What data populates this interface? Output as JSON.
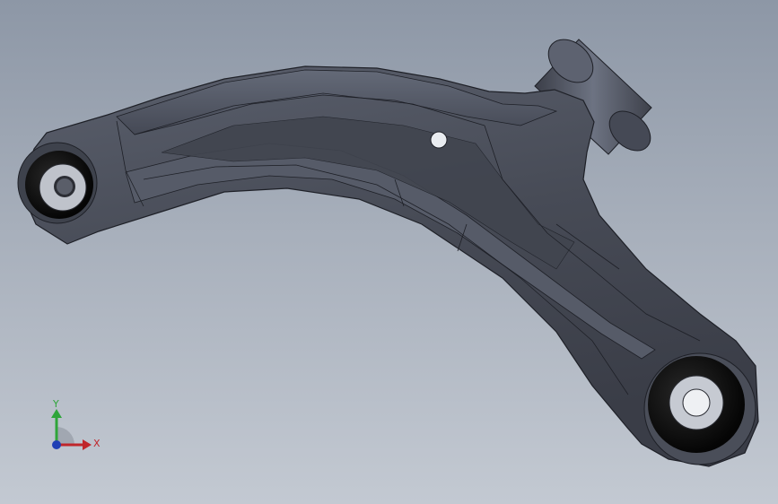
{
  "view": {
    "background_top": "#8d97a6",
    "background_bottom": "#c3c9d2"
  },
  "model": {
    "name": "lower-control-arm",
    "body_color": "#4a4e59",
    "edge_color": "#1e2027",
    "bushing_color": "#101010",
    "sleeve_color": "#c8ccd4"
  },
  "triad": {
    "x_label": "X",
    "y_label": "Y",
    "x_color": "#c0262b",
    "y_color": "#2fa53a",
    "z_color": "#1f3fb5"
  }
}
